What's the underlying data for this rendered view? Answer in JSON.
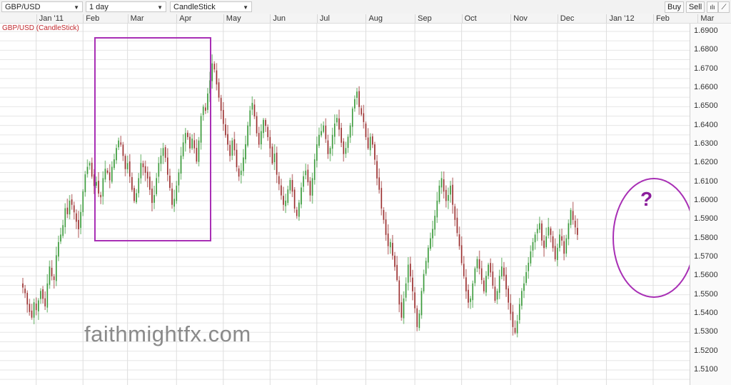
{
  "toolbar": {
    "symbol": "GBP/USD",
    "interval": "1 day",
    "chart_type": "CandleStick",
    "buy_label": "Buy",
    "sell_label": "Sell",
    "indicator_icon": "indicators-icon",
    "draw_icon": "draw-line-icon"
  },
  "chart_title": "GBP/USD (CandleStick)",
  "watermark": "faithmightfx.com",
  "annotation_question": "?",
  "colors": {
    "up": "#3a9a3a",
    "down": "#9b2f2f",
    "annotation": "#a82fb5",
    "title": "#c0282d"
  },
  "chart_data": {
    "type": "candlestick",
    "title": "GBP/USD (CandleStick)",
    "xlabel": "",
    "ylabel": "",
    "ylim": [
      1.505,
      1.695
    ],
    "grid": true,
    "x_tick_labels": [
      "Jan '11",
      "Feb",
      "Mar",
      "Apr",
      "May",
      "Jun",
      "Jul",
      "Aug",
      "Sep",
      "Oct",
      "Nov",
      "Dec",
      "Jan '12",
      "Feb",
      "Mar"
    ],
    "y_tick_labels": [
      "1.6900",
      "1.6800",
      "1.6700",
      "1.6600",
      "1.6500",
      "1.6400",
      "1.6300",
      "1.6200",
      "1.6100",
      "1.6000",
      "1.5900",
      "1.5800",
      "1.5700",
      "1.5600",
      "1.5500",
      "1.5400",
      "1.5300",
      "1.5200",
      "1.5100"
    ],
    "y_ticks": [
      1.69,
      1.68,
      1.67,
      1.66,
      1.65,
      1.64,
      1.63,
      1.62,
      1.61,
      1.6,
      1.59,
      1.58,
      1.57,
      1.56,
      1.55,
      1.54,
      1.53,
      1.52,
      1.51
    ],
    "x_tick_positions_index": [
      6,
      27,
      47,
      69,
      90,
      111,
      132,
      154,
      176,
      197,
      219,
      240,
      262,
      283,
      303
    ],
    "close": [
      1.554,
      1.551,
      1.545,
      1.541,
      1.538,
      1.546,
      1.542,
      1.547,
      1.552,
      1.548,
      1.544,
      1.556,
      1.565,
      1.56,
      1.558,
      1.571,
      1.578,
      1.582,
      1.587,
      1.596,
      1.593,
      1.6,
      1.598,
      1.594,
      1.589,
      1.585,
      1.594,
      1.605,
      1.614,
      1.618,
      1.62,
      1.613,
      1.608,
      1.61,
      1.604,
      1.602,
      1.612,
      1.617,
      1.615,
      1.611,
      1.618,
      1.622,
      1.628,
      1.632,
      1.63,
      1.624,
      1.617,
      1.62,
      1.613,
      1.606,
      1.6,
      1.604,
      1.612,
      1.62,
      1.618,
      1.615,
      1.612,
      1.606,
      1.599,
      1.603,
      1.612,
      1.62,
      1.624,
      1.628,
      1.623,
      1.614,
      1.607,
      1.598,
      1.601,
      1.608,
      1.615,
      1.624,
      1.631,
      1.636,
      1.634,
      1.628,
      1.633,
      1.628,
      1.621,
      1.632,
      1.645,
      1.65,
      1.648,
      1.657,
      1.664,
      1.673,
      1.67,
      1.662,
      1.655,
      1.648,
      1.641,
      1.635,
      1.63,
      1.624,
      1.632,
      1.627,
      1.618,
      1.613,
      1.616,
      1.623,
      1.63,
      1.64,
      1.648,
      1.652,
      1.645,
      1.636,
      1.63,
      1.637,
      1.643,
      1.64,
      1.634,
      1.628,
      1.62,
      1.625,
      1.614,
      1.609,
      1.603,
      1.598,
      1.6,
      1.606,
      1.611,
      1.605,
      1.596,
      1.592,
      1.599,
      1.607,
      1.613,
      1.616,
      1.61,
      1.603,
      1.612,
      1.622,
      1.63,
      1.635,
      1.637,
      1.64,
      1.633,
      1.625,
      1.628,
      1.635,
      1.641,
      1.644,
      1.638,
      1.631,
      1.625,
      1.628,
      1.634,
      1.64,
      1.649,
      1.654,
      1.658,
      1.65,
      1.646,
      1.642,
      1.634,
      1.628,
      1.634,
      1.63,
      1.622,
      1.612,
      1.606,
      1.596,
      1.59,
      1.582,
      1.576,
      1.578,
      1.571,
      1.565,
      1.558,
      1.545,
      1.538,
      1.548,
      1.556,
      1.566,
      1.56,
      1.552,
      1.543,
      1.533,
      1.54,
      1.552,
      1.561,
      1.568,
      1.575,
      1.58,
      1.585,
      1.592,
      1.6,
      1.608,
      1.612,
      1.605,
      1.6,
      1.603,
      1.608,
      1.598,
      1.59,
      1.583,
      1.576,
      1.567,
      1.56,
      1.552,
      1.546,
      1.548,
      1.556,
      1.564,
      1.569,
      1.564,
      1.558,
      1.552,
      1.56,
      1.566,
      1.562,
      1.555,
      1.547,
      1.552,
      1.56,
      1.565,
      1.56,
      1.553,
      1.546,
      1.54,
      1.533,
      1.53,
      1.536,
      1.545,
      1.552,
      1.556,
      1.562,
      1.567,
      1.573,
      1.578,
      1.582,
      1.585,
      1.588,
      1.579,
      1.575,
      1.581,
      1.586,
      1.582,
      1.575,
      1.569,
      1.575,
      1.582,
      1.579,
      1.572,
      1.58,
      1.588,
      1.595,
      1.59,
      1.586,
      1.582
    ]
  }
}
